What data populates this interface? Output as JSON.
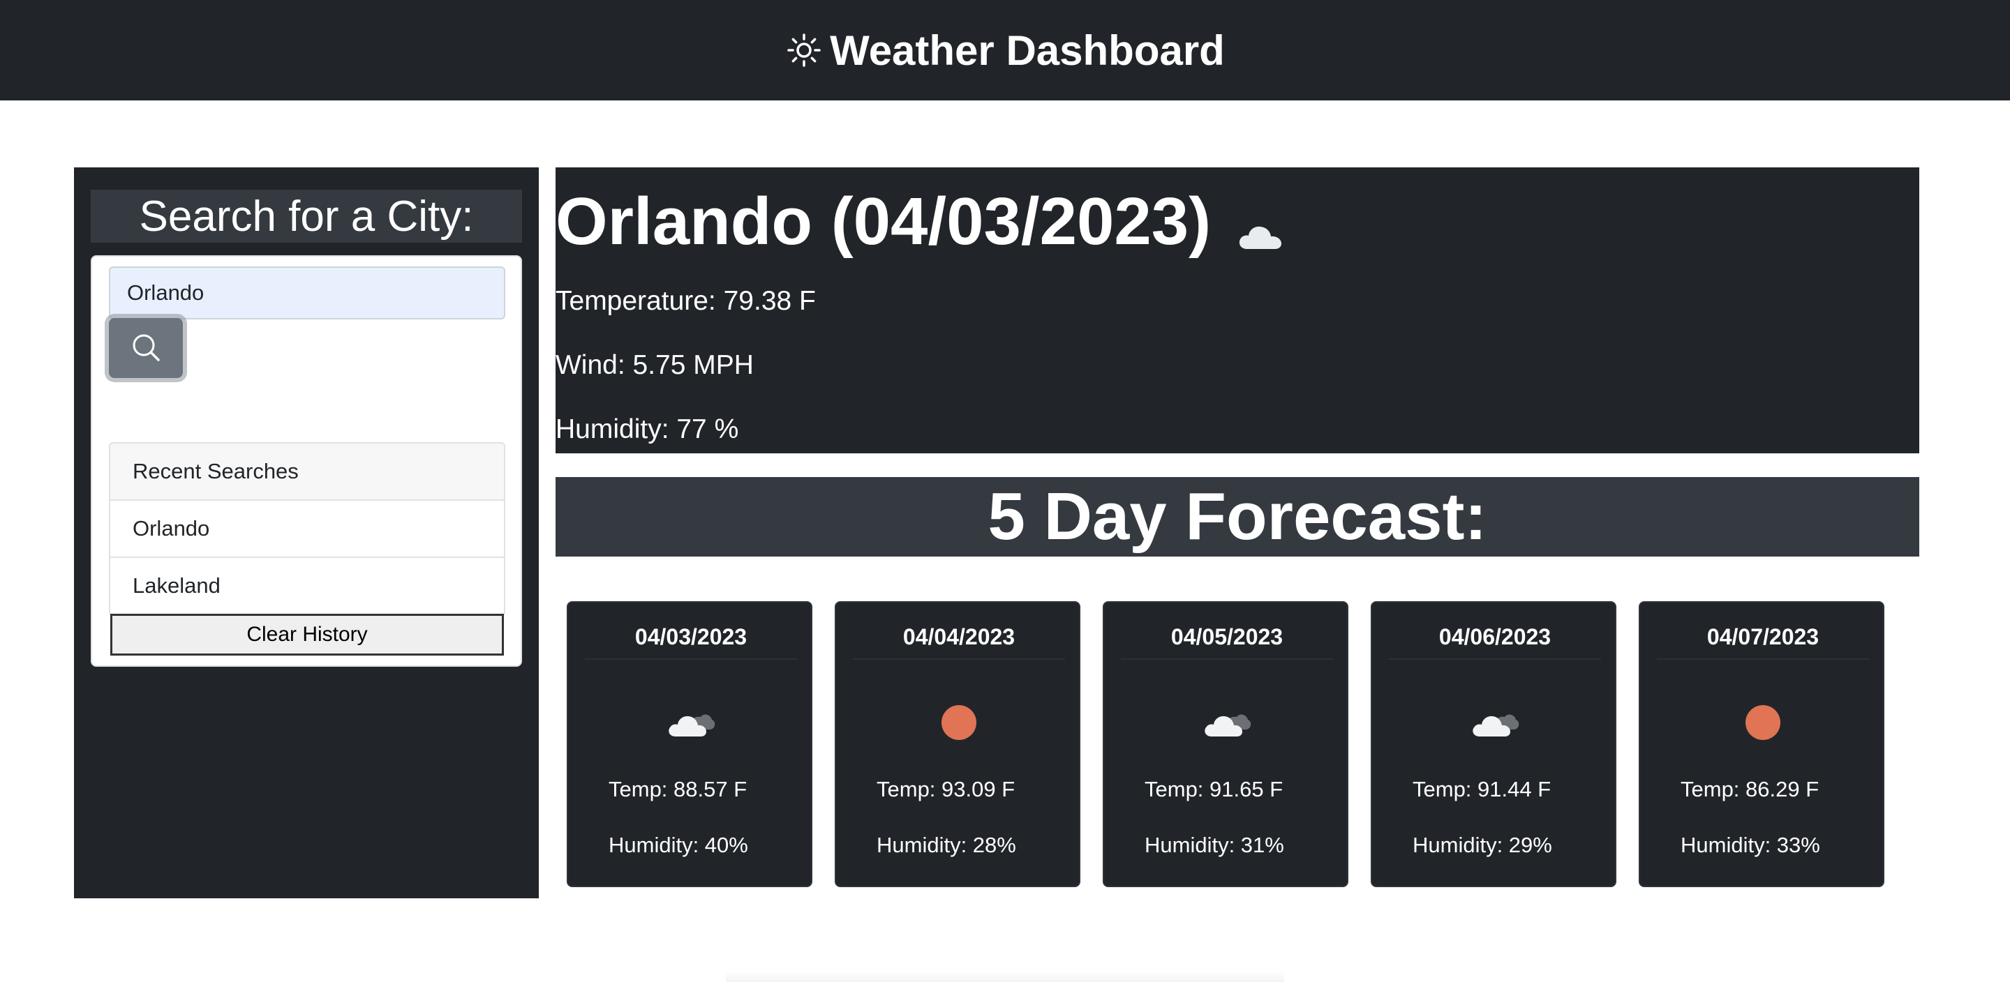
{
  "header": {
    "title": "Weather Dashboard",
    "icon": "sun-outline-icon"
  },
  "sidebar": {
    "heading": "Search for a City:",
    "search": {
      "value": "Orlando",
      "button_icon": "search-icon"
    },
    "recent": {
      "header": "Recent Searches",
      "items": [
        "Orlando",
        "Lakeland"
      ]
    },
    "clear_label": "Clear History"
  },
  "current": {
    "city_date": "Orlando (04/03/2023)",
    "icon": "cloud-icon",
    "temperature": "Temperature: 79.38 F",
    "wind": "Wind: 5.75 MPH",
    "humidity": "Humidity: 77 %"
  },
  "forecast": {
    "heading": "5 Day Forecast:",
    "days": [
      {
        "date": "04/03/2023",
        "icon": "cloudy-icon",
        "temp": "Temp: 88.57 F",
        "humidity": "Humidity: 40%"
      },
      {
        "date": "04/04/2023",
        "icon": "sun-icon",
        "temp": "Temp: 93.09 F",
        "humidity": "Humidity: 28%"
      },
      {
        "date": "04/05/2023",
        "icon": "cloudy-icon",
        "temp": "Temp: 91.65 F",
        "humidity": "Humidity: 31%"
      },
      {
        "date": "04/06/2023",
        "icon": "cloudy-icon",
        "temp": "Temp: 91.44 F",
        "humidity": "Humidity: 29%"
      },
      {
        "date": "04/07/2023",
        "icon": "sun-icon",
        "temp": "Temp: 86.29 F",
        "humidity": "Humidity: 33%"
      }
    ]
  },
  "colors": {
    "dark": "#212529",
    "heading_bg": "#343a40",
    "sun": "#e07454",
    "button": "#6c757d"
  }
}
